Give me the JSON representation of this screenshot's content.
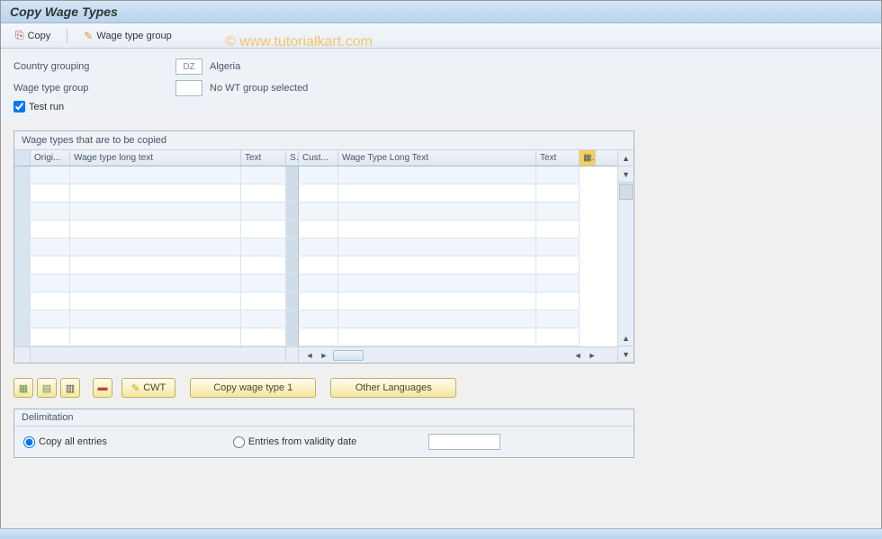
{
  "title": "Copy Wage Types",
  "watermark": "© www.tutorialkart.com",
  "toolbar": {
    "copy_label": "Copy",
    "wagegroup_label": "Wage type group"
  },
  "form": {
    "country_label": "Country grouping",
    "country_code": "DZ",
    "country_name": "Algeria",
    "wagegroup_label": "Wage type group",
    "wagegroup_value": "",
    "wagegroup_text": "No WT group selected",
    "testrun_label": "Test run",
    "testrun_checked": true
  },
  "table": {
    "title": "Wage types that are to be copied",
    "columns": {
      "origi": "Origi...",
      "longtext1": "Wage type long text",
      "text1": "Text",
      "s": "S",
      "cust": "Cust...",
      "longtext2": "Wage Type Long Text",
      "text2": "Text"
    },
    "row_count": 10
  },
  "buttons": {
    "cwt": "CWT",
    "copy_wage_type_1": "Copy wage type 1",
    "other_languages": "Other Languages"
  },
  "delimitation": {
    "title": "Delimitation",
    "copy_all": "Copy all entries",
    "entries_from": "Entries from validity date"
  }
}
